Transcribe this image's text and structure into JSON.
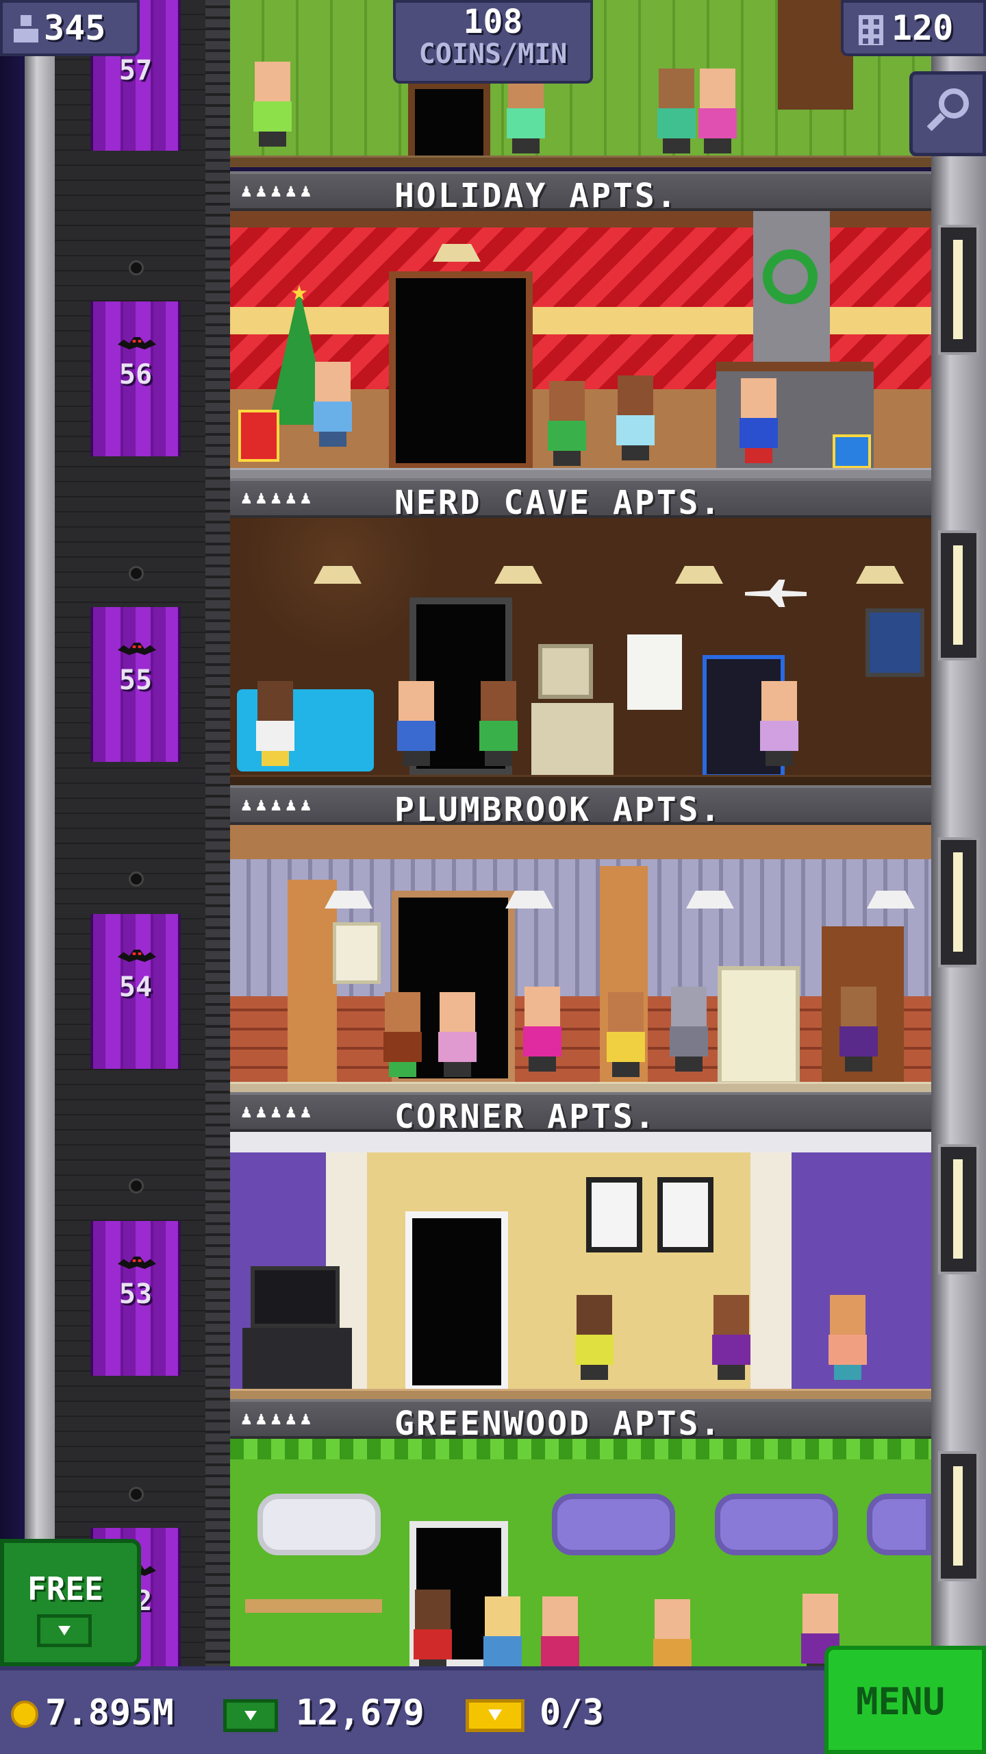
{
  "hud": {
    "population": "345",
    "coins_rate_value": "108",
    "coins_rate_unit": "COINS/MIN",
    "floors_count": "120"
  },
  "elevator": {
    "floor_numbers": [
      "57",
      "56",
      "55",
      "54",
      "53",
      "52"
    ]
  },
  "floors": [
    {
      "name": "HOLIDAY APTS.",
      "stars": "♟♟♟♟♟"
    },
    {
      "name": "NERD CAVE APTS.",
      "stars": "♟♟♟♟♟"
    },
    {
      "name": "PLUMBROOK APTS.",
      "stars": "♟♟♟♟♟"
    },
    {
      "name": "CORNER APTS.",
      "stars": "♟♟♟♟♟"
    },
    {
      "name": "GREENWOOD APTS.",
      "stars": "♟♟♟♟♟"
    }
  ],
  "free_button": {
    "label": "FREE"
  },
  "bottom_bar": {
    "coins": "7.895M",
    "tower_bux": "12,679",
    "tickets": "0/3",
    "menu_label": "MENU"
  },
  "icons": {
    "population": "person-icon",
    "floors": "building-icon",
    "search": "magnifier-icon",
    "coin": "coin-icon",
    "bux": "bux-icon",
    "ticket": "ticket-icon"
  },
  "colors": {
    "accent_green": "#22c62c",
    "hud_purple": "#4c4d7a",
    "elevator_purple": "#9b2ad0"
  }
}
